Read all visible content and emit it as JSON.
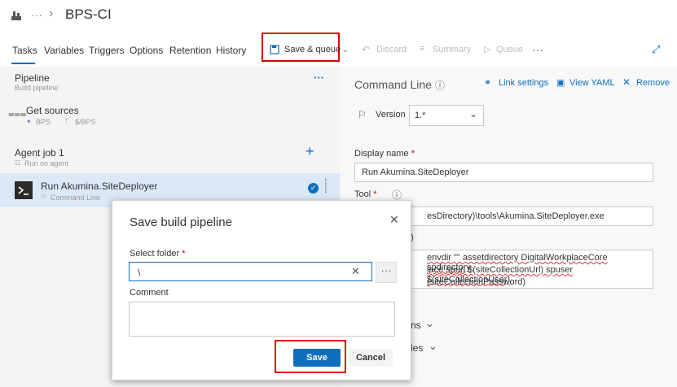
{
  "header": {
    "pipeline_title": "BPS-CI",
    "breadcrumb_more": "···",
    "breadcrumb_sep": "›"
  },
  "tabs": [
    "Tasks",
    "Variables",
    "Triggers",
    "Options",
    "Retention",
    "History"
  ],
  "toolbar": {
    "save_queue": "Save & queue",
    "discard": "Discard",
    "summary": "Summary",
    "queue": "Queue",
    "more": "···"
  },
  "left": {
    "pipeline_title": "Pipeline",
    "pipeline_sub": "Build pipeline",
    "pipeline_more": "···",
    "get_sources": "Get sources",
    "repo_name": "BPS",
    "branch": "$/BPS",
    "agent_job": "Agent job 1",
    "agent_sub": "Run on agent",
    "task_name": "Run Akumina.SiteDeployer",
    "task_sub": "Command Line"
  },
  "right": {
    "panel_title": "Command Line",
    "link_settings": "Link settings",
    "view_yaml": "View YAML",
    "remove": "Remove",
    "version_label": "Version",
    "version_value": "1.*",
    "display_name_label": "Display name",
    "display_name_value": "Run Akumina.SiteDeployer",
    "tool_label": "Tool",
    "tool_value_visible": "esDirectory)\\tools\\Akumina.SiteDeployer.exe",
    "args_label_fragment": ")",
    "args_line1": "envdir \"\" assetdirectory DigitalWorkplaceCore spdirectory",
    "args_line2": "lace spurl $(siteCollectionUrl) spuser $(siteCollectionUser)",
    "args_line3": "(siteCollectionPassword)",
    "section1": "ns",
    "section2": "les"
  },
  "dialog": {
    "title": "Save build pipeline",
    "folder_label": "Select folder",
    "folder_value": "\\",
    "comment_label": "Comment",
    "comment_value": "",
    "save_button": "Save",
    "cancel_button": "Cancel"
  },
  "colors": {
    "accent": "#106ebe",
    "highlight": "#e00000"
  }
}
